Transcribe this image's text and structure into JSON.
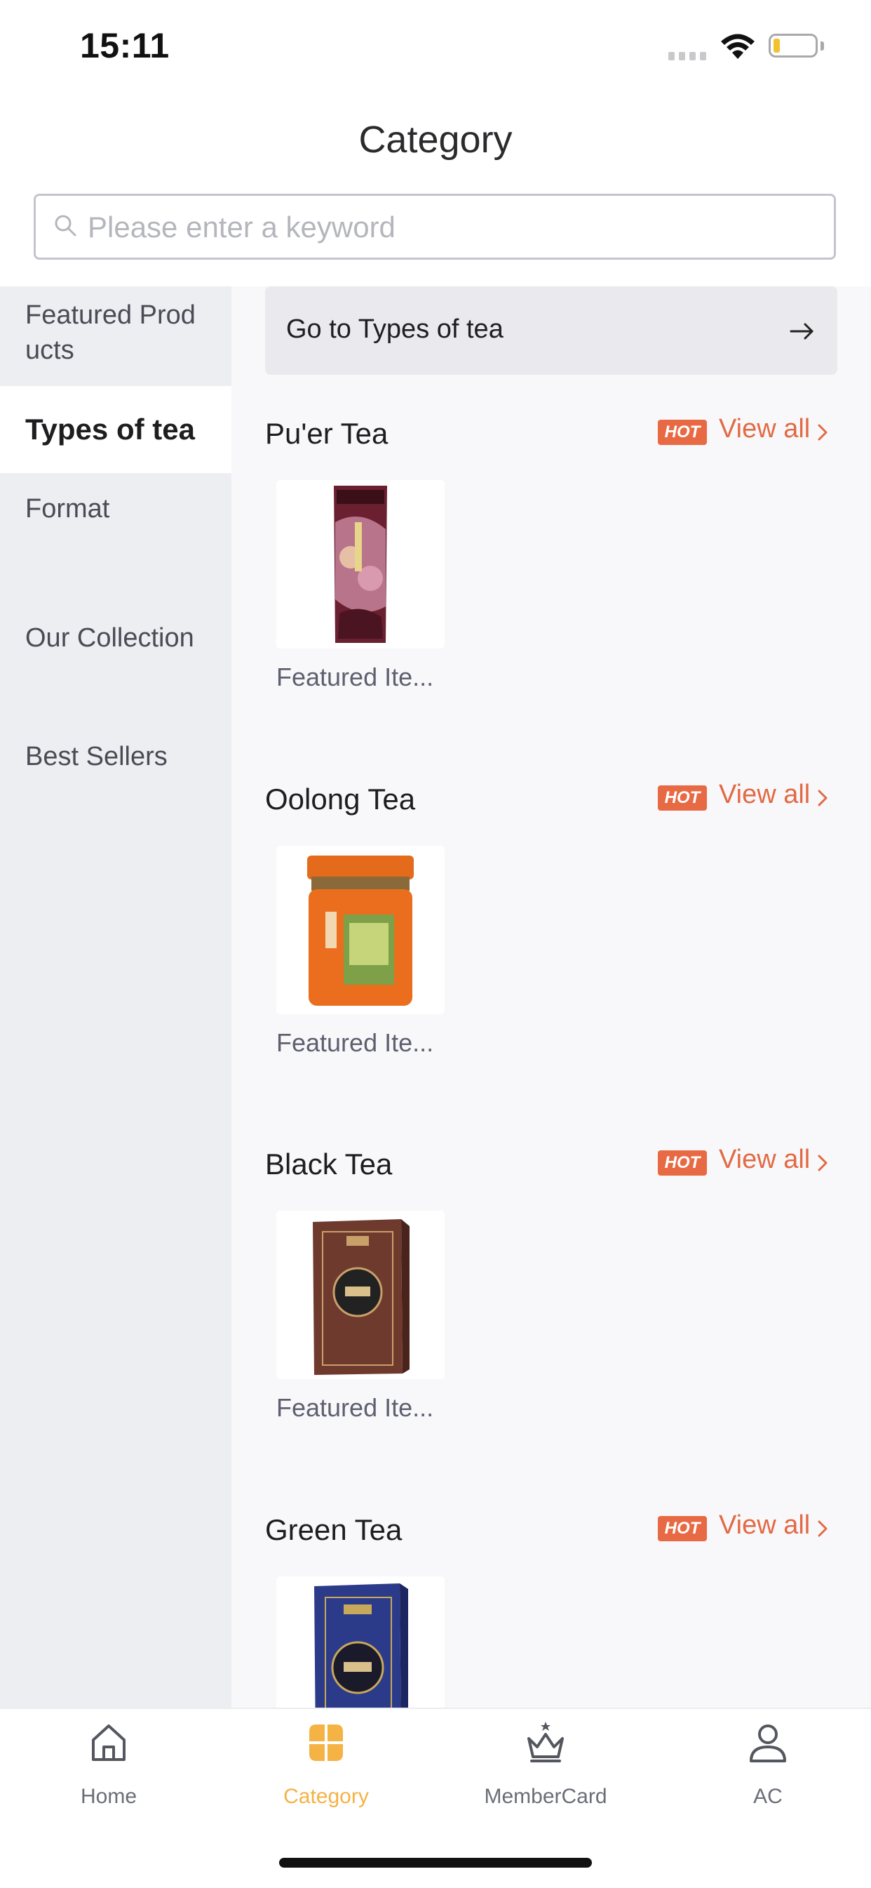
{
  "status_bar": {
    "time": "15:11"
  },
  "header": {
    "title": "Category"
  },
  "search": {
    "placeholder": "Please enter a keyword",
    "value": ""
  },
  "sidebar": {
    "items": [
      {
        "label": "Featured Products",
        "active": false
      },
      {
        "label": "Types of tea",
        "active": true
      },
      {
        "label": "Format",
        "active": false
      },
      {
        "label": "Our Collection",
        "active": false
      },
      {
        "label": "Best Sellers",
        "active": false
      }
    ]
  },
  "main": {
    "banner": {
      "label": "Go to Types of tea",
      "icon": "arrow-right-icon"
    },
    "sections": [
      {
        "title": "Pu'er Tea",
        "badge": "HOT",
        "view_all": "View all",
        "product": {
          "name": "Featured Ite...",
          "image": "puer-tea-package"
        }
      },
      {
        "title": "Oolong Tea",
        "badge": "HOT",
        "view_all": "View all",
        "product": {
          "name": "Featured Ite...",
          "image": "oolong-tea-tin"
        }
      },
      {
        "title": "Black Tea",
        "badge": "HOT",
        "view_all": "View all",
        "product": {
          "name": "Featured Ite...",
          "image": "black-tea-box"
        }
      },
      {
        "title": "Green Tea",
        "badge": "HOT",
        "view_all": "View all",
        "product": {
          "name": "",
          "image": "green-tea-box"
        }
      }
    ]
  },
  "tabbar": {
    "items": [
      {
        "label": "Home",
        "icon": "home-icon",
        "active": false
      },
      {
        "label": "Category",
        "icon": "category-icon",
        "active": true
      },
      {
        "label": "MemberCard",
        "icon": "crown-icon",
        "active": false
      },
      {
        "label": "AC",
        "icon": "person-icon",
        "active": false
      }
    ]
  },
  "colors": {
    "accent": "#e86a44",
    "active_tab": "#f5b245",
    "sidebar_bg": "#eceef2"
  }
}
